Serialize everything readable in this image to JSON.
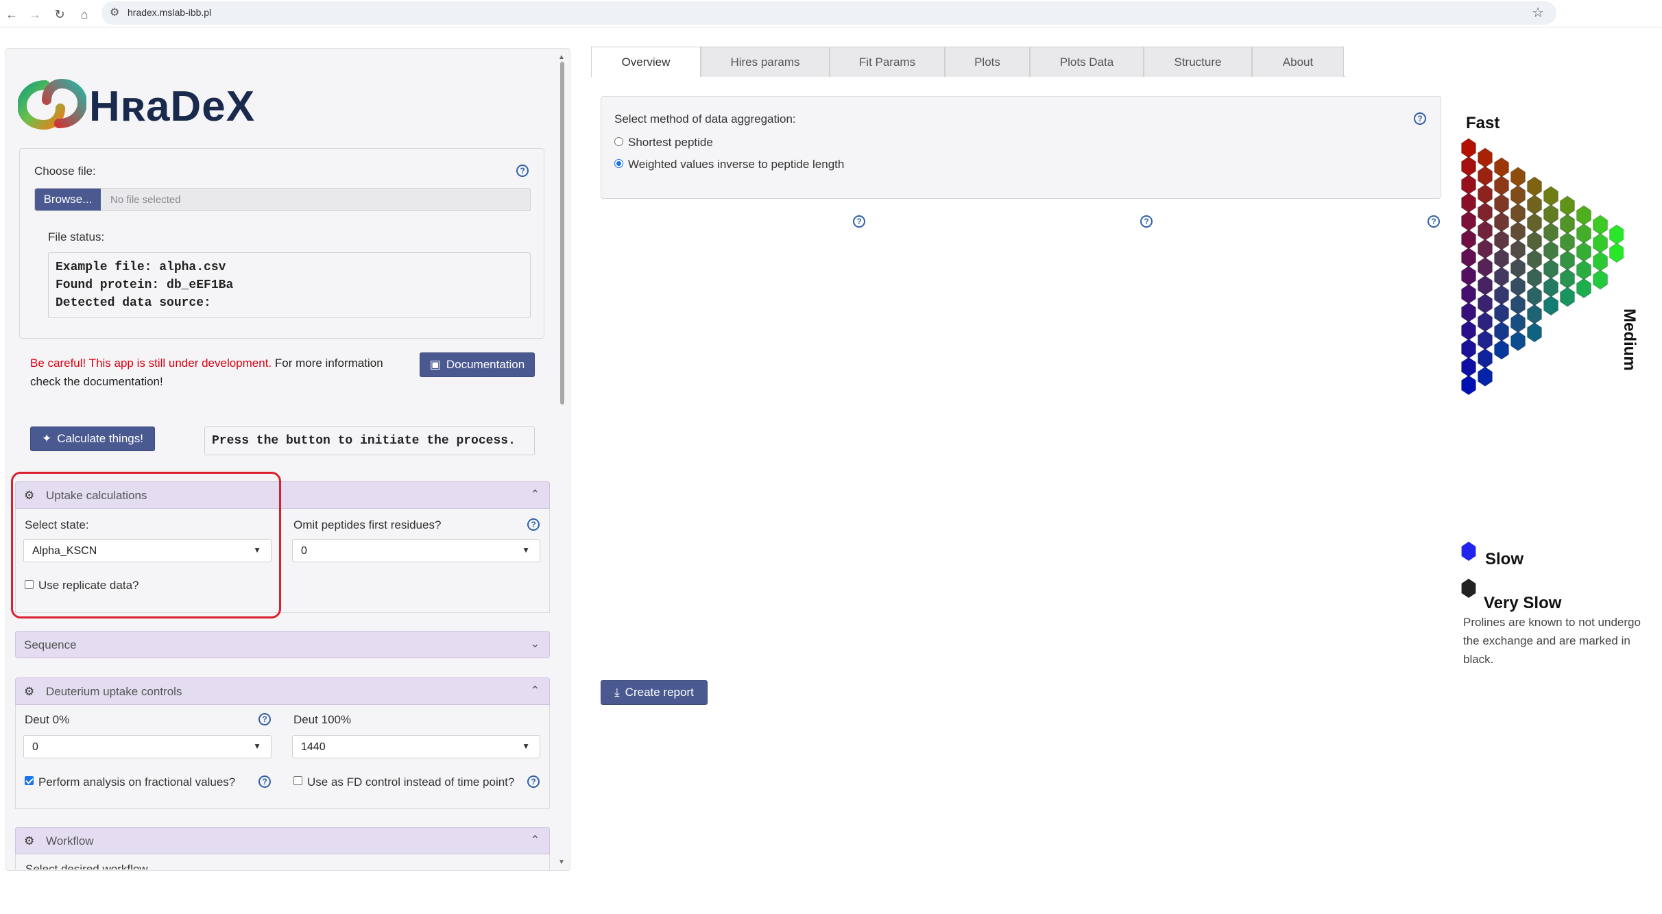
{
  "browser": {
    "url": "hradex.mslab-ibb.pl"
  },
  "app": {
    "logo_text": "HʀaDeX"
  },
  "file": {
    "choose_label": "Choose file:",
    "browse_label": "Browse...",
    "placeholder": "No file selected",
    "status_label": "File status:",
    "status_lines": [
      "Example file: alpha.csv",
      "Found protein: db_eEF1Ba",
      "Detected data source:"
    ]
  },
  "warning": {
    "red": "Be careful! This app is still under development.",
    "rest": " For more information check the documentation!"
  },
  "buttons": {
    "documentation": "Documentation",
    "calculate": "Calculate things!",
    "press_message": "Press the button to initiate the process.",
    "create_report": "Create report"
  },
  "uptake": {
    "title": "Uptake calculations",
    "select_state_label": "Select state:",
    "state_value": "Alpha_KSCN",
    "omit_label": "Omit peptides first residues?",
    "omit_value": "0",
    "replicate_label": "Use replicate data?"
  },
  "sequence": {
    "title": "Sequence"
  },
  "deuterium": {
    "title": "Deuterium uptake controls",
    "deut0_label": "Deut 0%",
    "deut0_value": "0",
    "deut100_label": "Deut 100%",
    "deut100_value": "1440",
    "fractional_label": "Perform analysis on fractional values?",
    "fd_label": "Use as FD control instead of time point?"
  },
  "workflow": {
    "title": "Workflow",
    "subtitle": "Select desired workflow"
  },
  "tabs": [
    "Overview",
    "Hires params",
    "Fit Params",
    "Plots",
    "Plots Data",
    "Structure",
    "About"
  ],
  "aggregation": {
    "label": "Select method of data aggregation:",
    "options": [
      "Shortest peptide",
      "Weighted values inverse to peptide length"
    ],
    "selected_index": 1
  },
  "legend": {
    "fast": "Fast",
    "medium": "Medium",
    "slow": "Slow",
    "very_slow": "Very Slow",
    "note": "Prolines are known to not undergo the exchange and are marked in black."
  },
  "colors": {
    "accent": "#4a5a91",
    "accordion": "#e4dcf0",
    "warning": "#d9000f",
    "highlight": "#d8202e",
    "help": "#2f5fa8"
  }
}
